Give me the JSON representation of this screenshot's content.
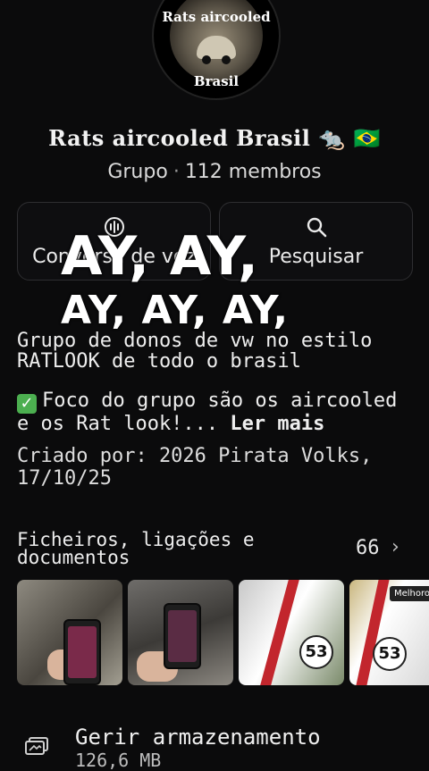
{
  "group": {
    "avatar_text_top": "Rats aircooled",
    "avatar_text_bottom": "Brasil",
    "name": "Rats aircooled Brasil 🐀 🇧🇷",
    "type": "Grupo",
    "separator": "·",
    "members": "112 membros"
  },
  "actions": {
    "voice_label": "Conversa de voz",
    "search_label": "Pesquisar"
  },
  "overlay": {
    "line1": "AY, AY,",
    "line2": "AY, AY, AY,"
  },
  "description": {
    "line1": "Grupo de donos de vw no estilo RATLOOK de todo o brasil",
    "line2": "Foco do grupo são os aircooled e os Rat look!...",
    "more": "Ler mais",
    "created": "Criado por: 2026 Pirata Volks, 17/10/25"
  },
  "files": {
    "title": "Ficheiros, ligações e documentos",
    "count": "66",
    "badge": "Melhorou"
  },
  "storage": {
    "title": "Gerir armazenamento",
    "size": "126,6 MB"
  }
}
